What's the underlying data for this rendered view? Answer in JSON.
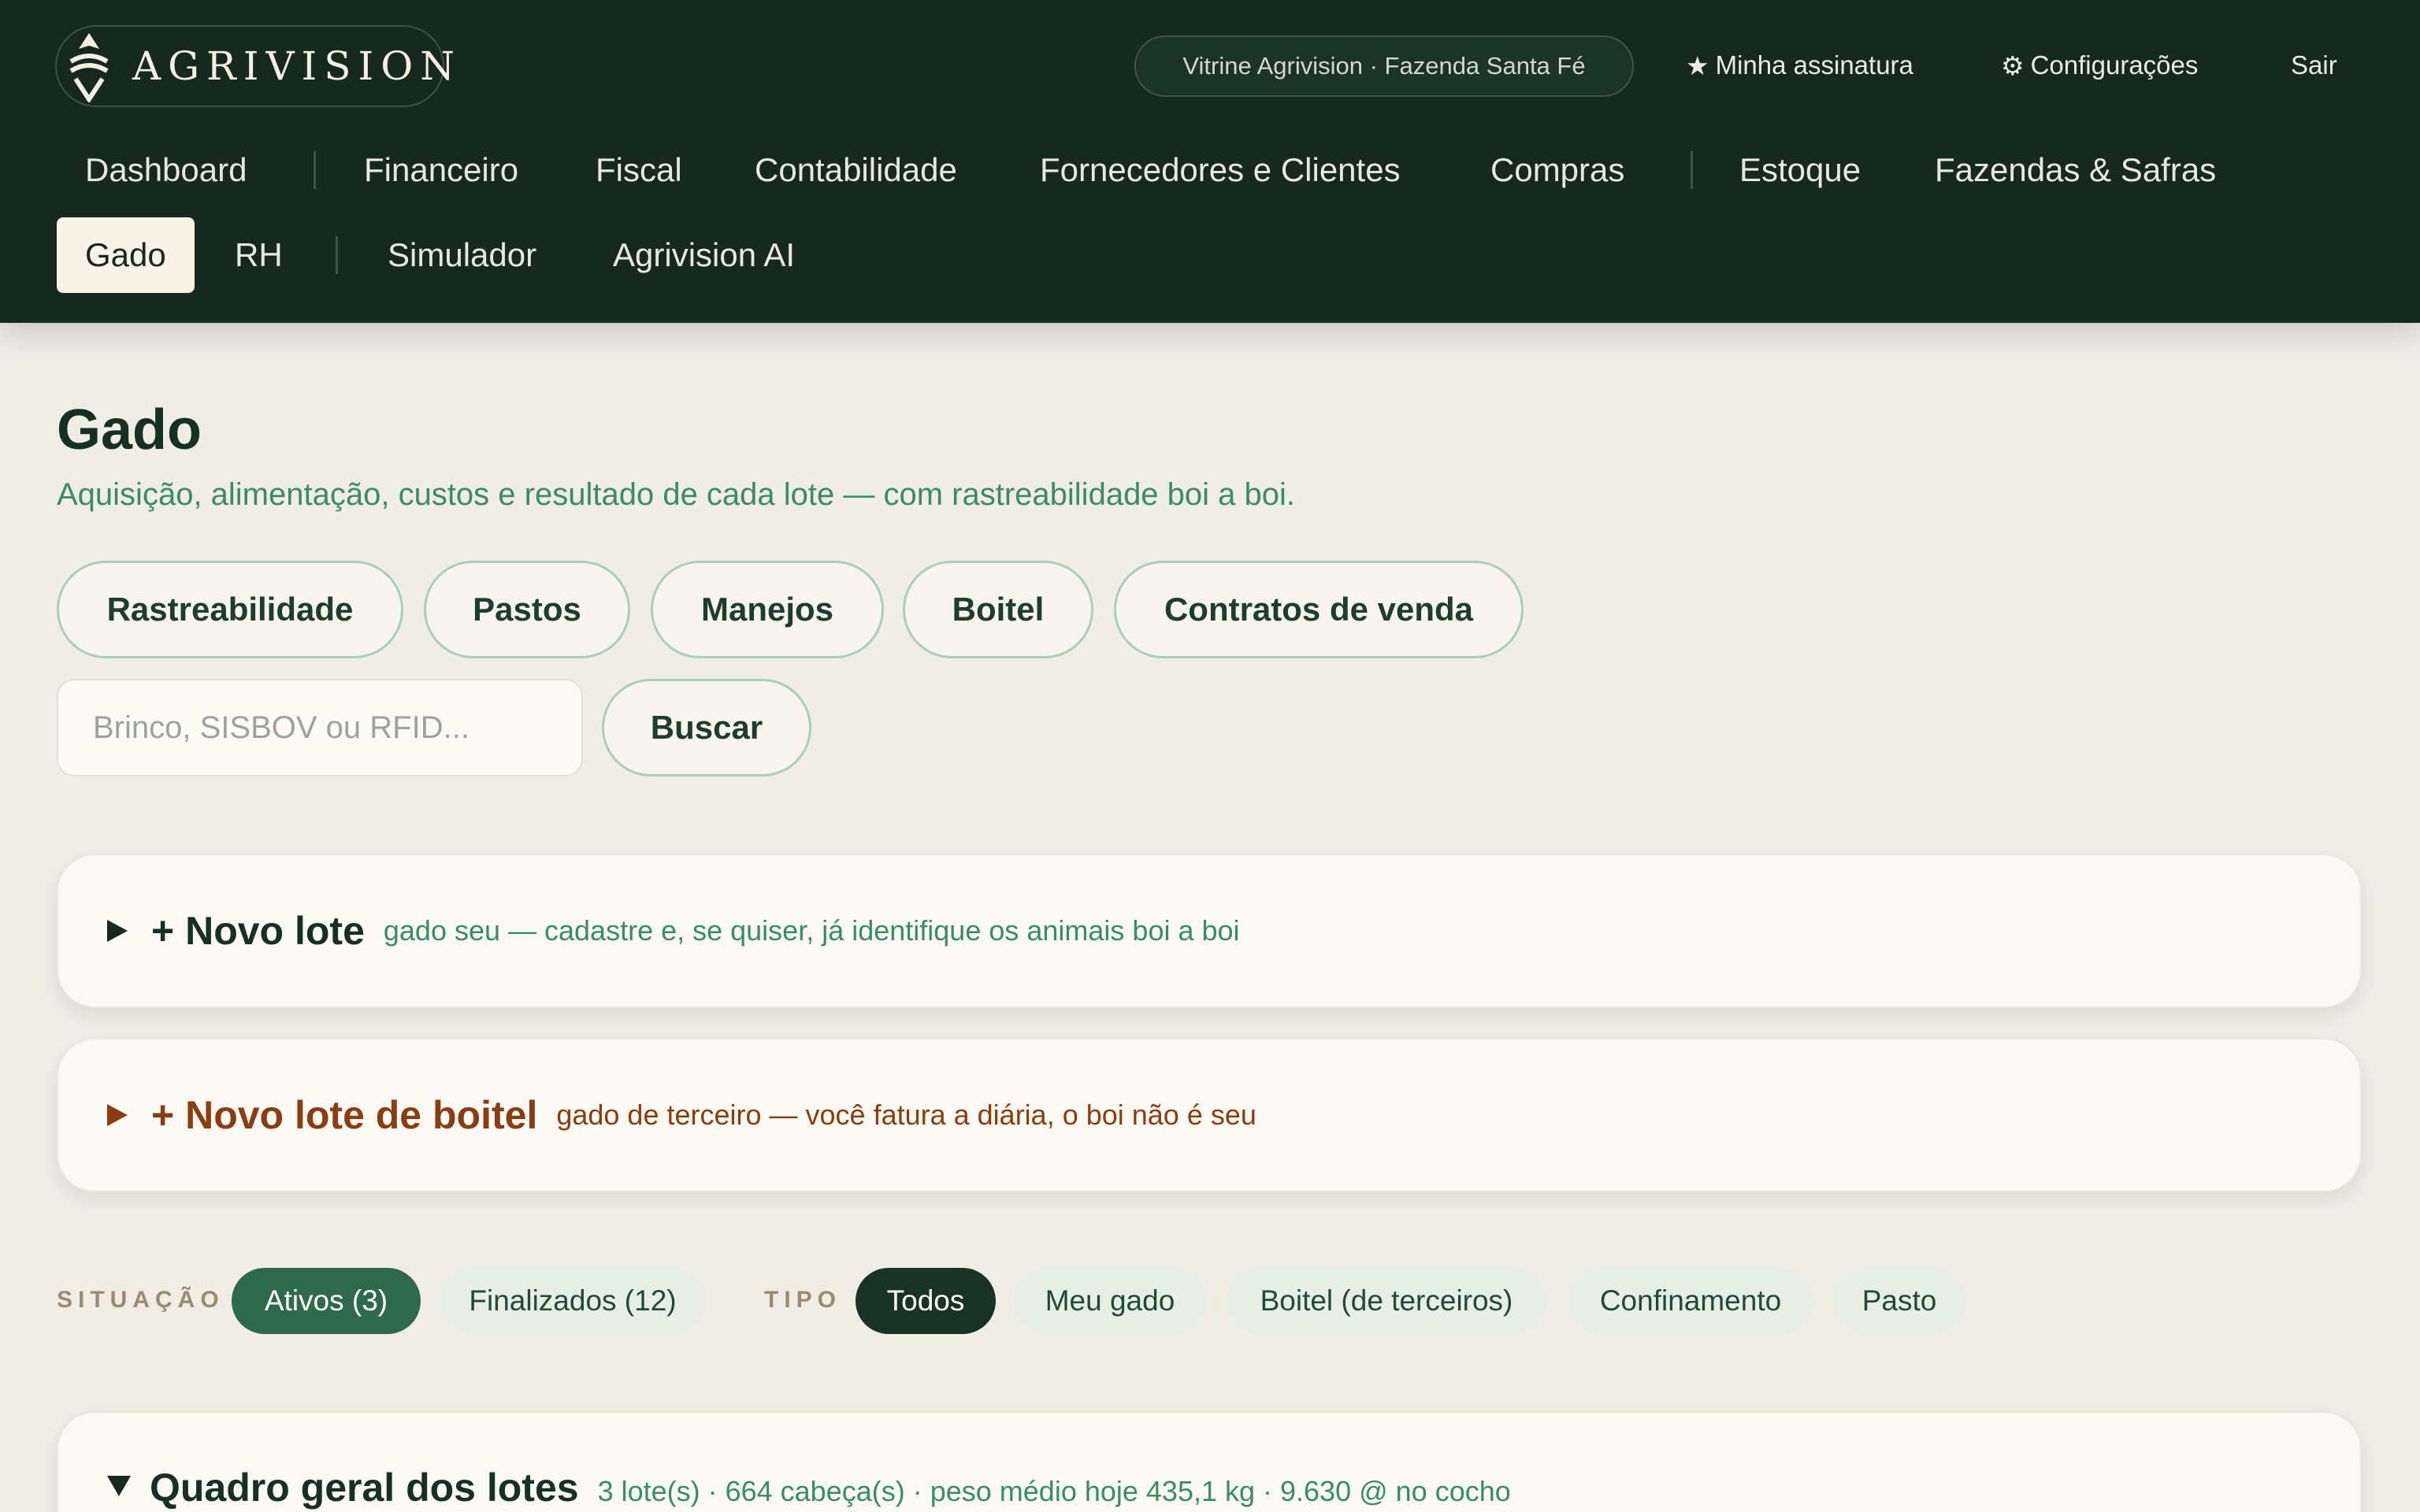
{
  "brand": {
    "name": "AGRIVISION"
  },
  "header": {
    "farm_pill": "Vitrine Agrivision · Fazenda Santa Fé",
    "subscription_icon": "star-icon",
    "subscription": "Minha assinatura",
    "settings_icon": "gear-icon",
    "settings": "Configurações",
    "logout": "Sair"
  },
  "nav": {
    "items": [
      {
        "label": "Dashboard"
      },
      {
        "label": "Financeiro"
      },
      {
        "label": "Fiscal"
      },
      {
        "label": "Contabilidade"
      },
      {
        "label": "Fornecedores e Clientes"
      },
      {
        "label": "Compras"
      },
      {
        "label": "Estoque"
      },
      {
        "label": "Fazendas & Safras"
      },
      {
        "label": "Gado",
        "active": true
      },
      {
        "label": "RH"
      },
      {
        "label": "Simulador"
      },
      {
        "label": "Agrivision AI"
      }
    ]
  },
  "page": {
    "title": "Gado",
    "subtitle": "Aquisição, alimentação, custos e resultado de cada lote — com rastreabilidade boi a boi."
  },
  "quick_links": [
    {
      "label": "Rastreabilidade"
    },
    {
      "label": "Pastos"
    },
    {
      "label": "Manejos"
    },
    {
      "label": "Boitel"
    },
    {
      "label": "Contratos de venda"
    }
  ],
  "search": {
    "placeholder": "Brinco, SISBOV ou RFID...",
    "value": "",
    "button": "Buscar"
  },
  "new_lot": {
    "title": "+ Novo lote",
    "hint": "gado seu — cadastre e, se quiser, já identifique os animais boi a boi"
  },
  "new_boitel": {
    "title": "+ Novo lote de boitel",
    "hint": "gado de terceiro — você fatura a diária, o boi não é seu"
  },
  "filters": {
    "status_label": "SITUAÇÃO",
    "status": [
      {
        "label": "Ativos (3)",
        "selected": true
      },
      {
        "label": "Finalizados (12)",
        "selected": false
      }
    ],
    "type_label": "TIPO",
    "types": [
      {
        "label": "Todos",
        "selected": true
      },
      {
        "label": "Meu gado",
        "selected": false
      },
      {
        "label": "Boitel (de terceiros)",
        "selected": false
      },
      {
        "label": "Confinamento",
        "selected": false
      },
      {
        "label": "Pasto",
        "selected": false
      }
    ]
  },
  "overview": {
    "title": "Quadro geral dos lotes",
    "meta": "3 lote(s) · 664 cabeça(s) · peso médio hoje 435,1 kg · 9.630 @ no cocho"
  },
  "colors": {
    "header_bg": "#15291f",
    "page_bg": "#efede4",
    "accent_green": "#3a8d62",
    "boitel_brown": "#8a3d12",
    "active_chip_green": "#2d6a4b"
  }
}
